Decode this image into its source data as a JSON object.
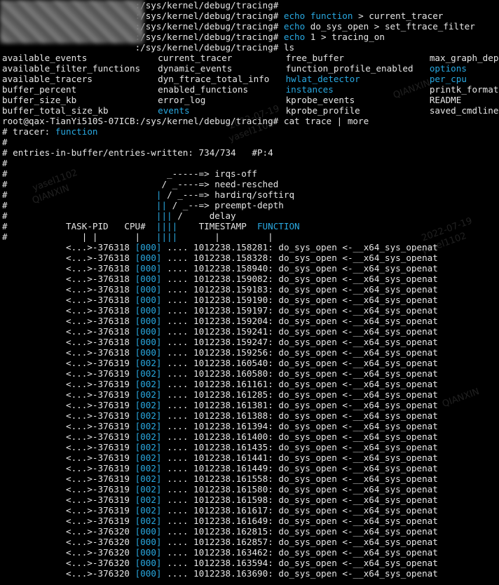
{
  "prompt_path": ":/sys/kernel/debug/tracing#",
  "commands": [
    {
      "kw": "",
      "rest": ""
    },
    {
      "kw": "echo",
      "kw2": "function",
      "rest": " > current_tracer"
    },
    {
      "kw": "echo",
      "kw2": "",
      "rest": " do_sys_open > set_ftrace_filter"
    },
    {
      "kw": "echo",
      "kw2": "",
      "rest": " 1 > tracing_on"
    },
    {
      "kw": "",
      "kw2": "",
      "rest": " ls"
    }
  ],
  "ls_rows": [
    [
      {
        "t": "available_events"
      },
      {
        "t": "current_tracer"
      },
      {
        "t": "free_buffer"
      },
      {
        "t": "max_graph_depth"
      }
    ],
    [
      {
        "t": "available_filter_functions"
      },
      {
        "t": "dynamic_events"
      },
      {
        "t": "function_profile_enabled"
      },
      {
        "t": "options",
        "dir": true
      }
    ],
    [
      {
        "t": "available_tracers"
      },
      {
        "t": "dyn_ftrace_total_info"
      },
      {
        "t": "hwlat_detector",
        "dir": true
      },
      {
        "t": "per_cpu",
        "dir": true
      }
    ],
    [
      {
        "t": "buffer_percent"
      },
      {
        "t": "enabled_functions"
      },
      {
        "t": "instances",
        "dir": true
      },
      {
        "t": "printk_formats"
      }
    ],
    [
      {
        "t": "buffer_size_kb"
      },
      {
        "t": "error_log"
      },
      {
        "t": "kprobe_events"
      },
      {
        "t": "README"
      }
    ],
    [
      {
        "t": "buffer_total_size_kb"
      },
      {
        "t": "events",
        "dir": true
      },
      {
        "t": "kprobe_profile"
      },
      {
        "t": "saved_cmdlines"
      }
    ]
  ],
  "full_prompt": "root@qax-TianYi510S-07ICB:/sys/kernel/debug/tracing#",
  "cat_cmd": " cat trace | more",
  "header": {
    "tracer_label": "# tracer: ",
    "tracer_value": "function",
    "lines": [
      "#",
      "# entries-in-buffer/entries-written: 734/734   #P:4",
      "#"
    ],
    "legend": [
      {
        "pre": "#                              ",
        "bar": "",
        "text": "_-----=> irqs-off"
      },
      {
        "pre": "#                             ",
        "bar": "",
        "text": "/ _----=> need-resched"
      },
      {
        "pre": "#                            ",
        "bar": "| ",
        "text": "/ _---=> hardirq/softirq"
      },
      {
        "pre": "#                            ",
        "bar": "|| ",
        "text": "/ _--=> preempt-depth"
      },
      {
        "pre": "#                            ",
        "bar": "||| ",
        "text": "/     delay"
      }
    ],
    "columns_pre": "#           TASK-PID   CPU#  ",
    "columns_bar": "||||",
    "columns_ts": "    TIMESTAMP  ",
    "columns_fn": "FUNCTION",
    "ticks_pre": "#              | |       |   ",
    "ticks_bar": "||||",
    "ticks_post": "       |         |"
  },
  "trace": [
    {
      "task": "<...>-376318",
      "cpu": "[000]",
      "flags": "....",
      "ts": "1012238.158281:",
      "fn": "do_sys_open <-__x64_sys_openat"
    },
    {
      "task": "<...>-376318",
      "cpu": "[000]",
      "flags": "....",
      "ts": "1012238.158328:",
      "fn": "do_sys_open <-__x64_sys_openat"
    },
    {
      "task": "<...>-376318",
      "cpu": "[000]",
      "flags": "....",
      "ts": "1012238.158940:",
      "fn": "do_sys_open <-__x64_sys_openat"
    },
    {
      "task": "<...>-376318",
      "cpu": "[000]",
      "flags": "....",
      "ts": "1012238.159082:",
      "fn": "do_sys_open <-__x64_sys_openat"
    },
    {
      "task": "<...>-376318",
      "cpu": "[000]",
      "flags": "....",
      "ts": "1012238.159183:",
      "fn": "do_sys_open <-__x64_sys_openat"
    },
    {
      "task": "<...>-376318",
      "cpu": "[000]",
      "flags": "....",
      "ts": "1012238.159190:",
      "fn": "do_sys_open <-__x64_sys_openat"
    },
    {
      "task": "<...>-376318",
      "cpu": "[000]",
      "flags": "....",
      "ts": "1012238.159197:",
      "fn": "do_sys_open <-__x64_sys_openat"
    },
    {
      "task": "<...>-376318",
      "cpu": "[000]",
      "flags": "....",
      "ts": "1012238.159204:",
      "fn": "do_sys_open <-__x64_sys_openat"
    },
    {
      "task": "<...>-376318",
      "cpu": "[000]",
      "flags": "....",
      "ts": "1012238.159241:",
      "fn": "do_sys_open <-__x64_sys_openat"
    },
    {
      "task": "<...>-376318",
      "cpu": "[000]",
      "flags": "....",
      "ts": "1012238.159247:",
      "fn": "do_sys_open <-__x64_sys_openat"
    },
    {
      "task": "<...>-376318",
      "cpu": "[000]",
      "flags": "....",
      "ts": "1012238.159256:",
      "fn": "do_sys_open <-__x64_sys_openat"
    },
    {
      "task": "<...>-376319",
      "cpu": "[002]",
      "flags": "....",
      "ts": "1012238.160540:",
      "fn": "do_sys_open <-__x64_sys_openat"
    },
    {
      "task": "<...>-376319",
      "cpu": "[002]",
      "flags": "....",
      "ts": "1012238.160580:",
      "fn": "do_sys_open <-__x64_sys_openat"
    },
    {
      "task": "<...>-376319",
      "cpu": "[002]",
      "flags": "....",
      "ts": "1012238.161161:",
      "fn": "do_sys_open <-__x64_sys_openat"
    },
    {
      "task": "<...>-376319",
      "cpu": "[002]",
      "flags": "....",
      "ts": "1012238.161285:",
      "fn": "do_sys_open <-__x64_sys_openat"
    },
    {
      "task": "<...>-376319",
      "cpu": "[002]",
      "flags": "....",
      "ts": "1012238.161381:",
      "fn": "do_sys_open <-__x64_sys_openat"
    },
    {
      "task": "<...>-376319",
      "cpu": "[002]",
      "flags": "....",
      "ts": "1012238.161388:",
      "fn": "do_sys_open <-__x64_sys_openat"
    },
    {
      "task": "<...>-376319",
      "cpu": "[002]",
      "flags": "....",
      "ts": "1012238.161394:",
      "fn": "do_sys_open <-__x64_sys_openat"
    },
    {
      "task": "<...>-376319",
      "cpu": "[002]",
      "flags": "....",
      "ts": "1012238.161400:",
      "fn": "do_sys_open <-__x64_sys_openat"
    },
    {
      "task": "<...>-376319",
      "cpu": "[002]",
      "flags": "....",
      "ts": "1012238.161435:",
      "fn": "do_sys_open <-__x64_sys_openat"
    },
    {
      "task": "<...>-376319",
      "cpu": "[002]",
      "flags": "....",
      "ts": "1012238.161441:",
      "fn": "do_sys_open <-__x64_sys_openat"
    },
    {
      "task": "<...>-376319",
      "cpu": "[002]",
      "flags": "....",
      "ts": "1012238.161449:",
      "fn": "do_sys_open <-__x64_sys_openat"
    },
    {
      "task": "<...>-376319",
      "cpu": "[002]",
      "flags": "....",
      "ts": "1012238.161558:",
      "fn": "do_sys_open <-__x64_sys_openat"
    },
    {
      "task": "<...>-376319",
      "cpu": "[002]",
      "flags": "....",
      "ts": "1012238.161580:",
      "fn": "do_sys_open <-__x64_sys_openat"
    },
    {
      "task": "<...>-376319",
      "cpu": "[002]",
      "flags": "....",
      "ts": "1012238.161598:",
      "fn": "do_sys_open <-__x64_sys_openat"
    },
    {
      "task": "<...>-376319",
      "cpu": "[002]",
      "flags": "....",
      "ts": "1012238.161617:",
      "fn": "do_sys_open <-__x64_sys_openat"
    },
    {
      "task": "<...>-376319",
      "cpu": "[002]",
      "flags": "....",
      "ts": "1012238.161649:",
      "fn": "do_sys_open <-__x64_sys_openat"
    },
    {
      "task": "<...>-376320",
      "cpu": "[000]",
      "flags": "....",
      "ts": "1012238.162815:",
      "fn": "do_sys_open <-__x64_sys_openat"
    },
    {
      "task": "<...>-376320",
      "cpu": "[000]",
      "flags": "....",
      "ts": "1012238.162857:",
      "fn": "do_sys_open <-__x64_sys_openat"
    },
    {
      "task": "<...>-376320",
      "cpu": "[000]",
      "flags": "....",
      "ts": "1012238.163462:",
      "fn": "do_sys_open <-__x64_sys_openat"
    },
    {
      "task": "<...>-376320",
      "cpu": "[000]",
      "flags": "....",
      "ts": "1012238.163594:",
      "fn": "do_sys_open <-__x64_sys_openat"
    },
    {
      "task": "<...>-376320",
      "cpu": "[000]",
      "flags": "....",
      "ts": "1012238.163690:",
      "fn": "do_sys_open <-__x64_sys_openat"
    }
  ],
  "watermarks": [
    {
      "text": "yasel1102"
    },
    {
      "text": "QIANXIN"
    },
    {
      "text": "2022-07-19"
    },
    {
      "text": "yasel1102"
    },
    {
      "text": "QIANXIN"
    },
    {
      "text": "2022-07-19"
    },
    {
      "text": "yasel1102"
    },
    {
      "text": "QIANXIN"
    }
  ],
  "colors": {
    "accent": "#29a8e0",
    "text": "#e6e6e6",
    "background": "#000000"
  }
}
